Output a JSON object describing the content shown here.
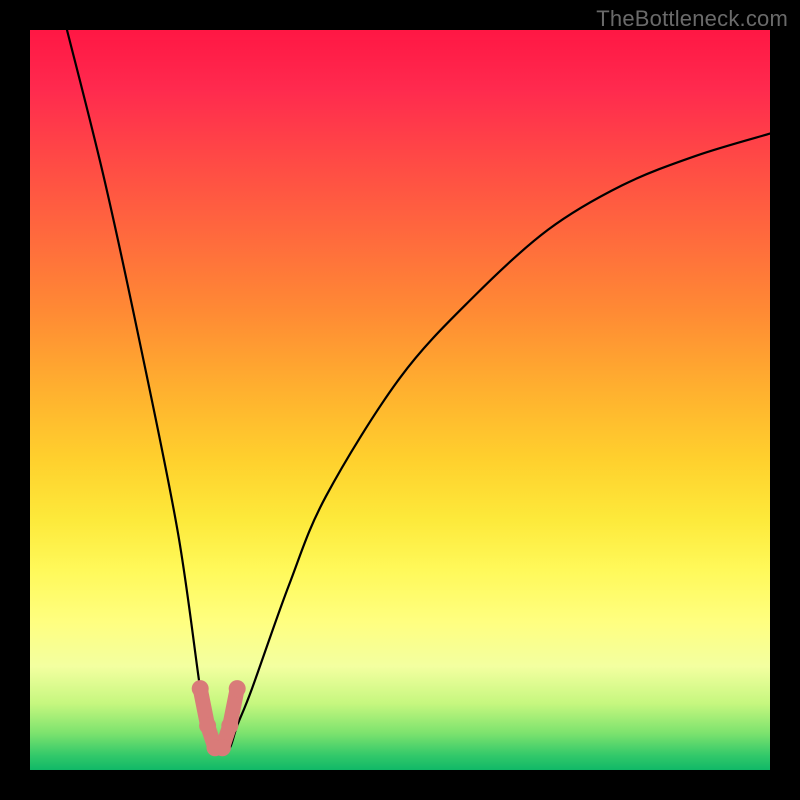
{
  "watermark": "TheBottleneck.com",
  "chart_data": {
    "type": "line",
    "title": "",
    "xlabel": "",
    "ylabel": "",
    "xlim": [
      0,
      100
    ],
    "ylim": [
      0,
      100
    ],
    "series": [
      {
        "name": "bottleneck-curve",
        "x": [
          5,
          10,
          15,
          20,
          23,
          24,
          25,
          26,
          27,
          28,
          30,
          35,
          40,
          50,
          60,
          70,
          80,
          90,
          100
        ],
        "values": [
          100,
          80,
          57,
          32,
          11,
          6,
          3,
          3,
          3,
          6,
          11,
          25,
          37,
          53,
          64,
          73,
          79,
          83,
          86
        ]
      }
    ],
    "annotations": [
      {
        "name": "highlight-valley",
        "type": "marker-pink-thick",
        "x": [
          23,
          24,
          25,
          26,
          27,
          28
        ],
        "values": [
          11,
          6,
          3,
          3,
          6,
          11
        ]
      }
    ],
    "background": {
      "type": "vertical-gradient",
      "stops": [
        {
          "pos": 0,
          "color": "#ff1744"
        },
        {
          "pos": 50,
          "color": "#ffc02d"
        },
        {
          "pos": 80,
          "color": "#ffff80"
        },
        {
          "pos": 100,
          "color": "#10b867"
        }
      ]
    }
  }
}
